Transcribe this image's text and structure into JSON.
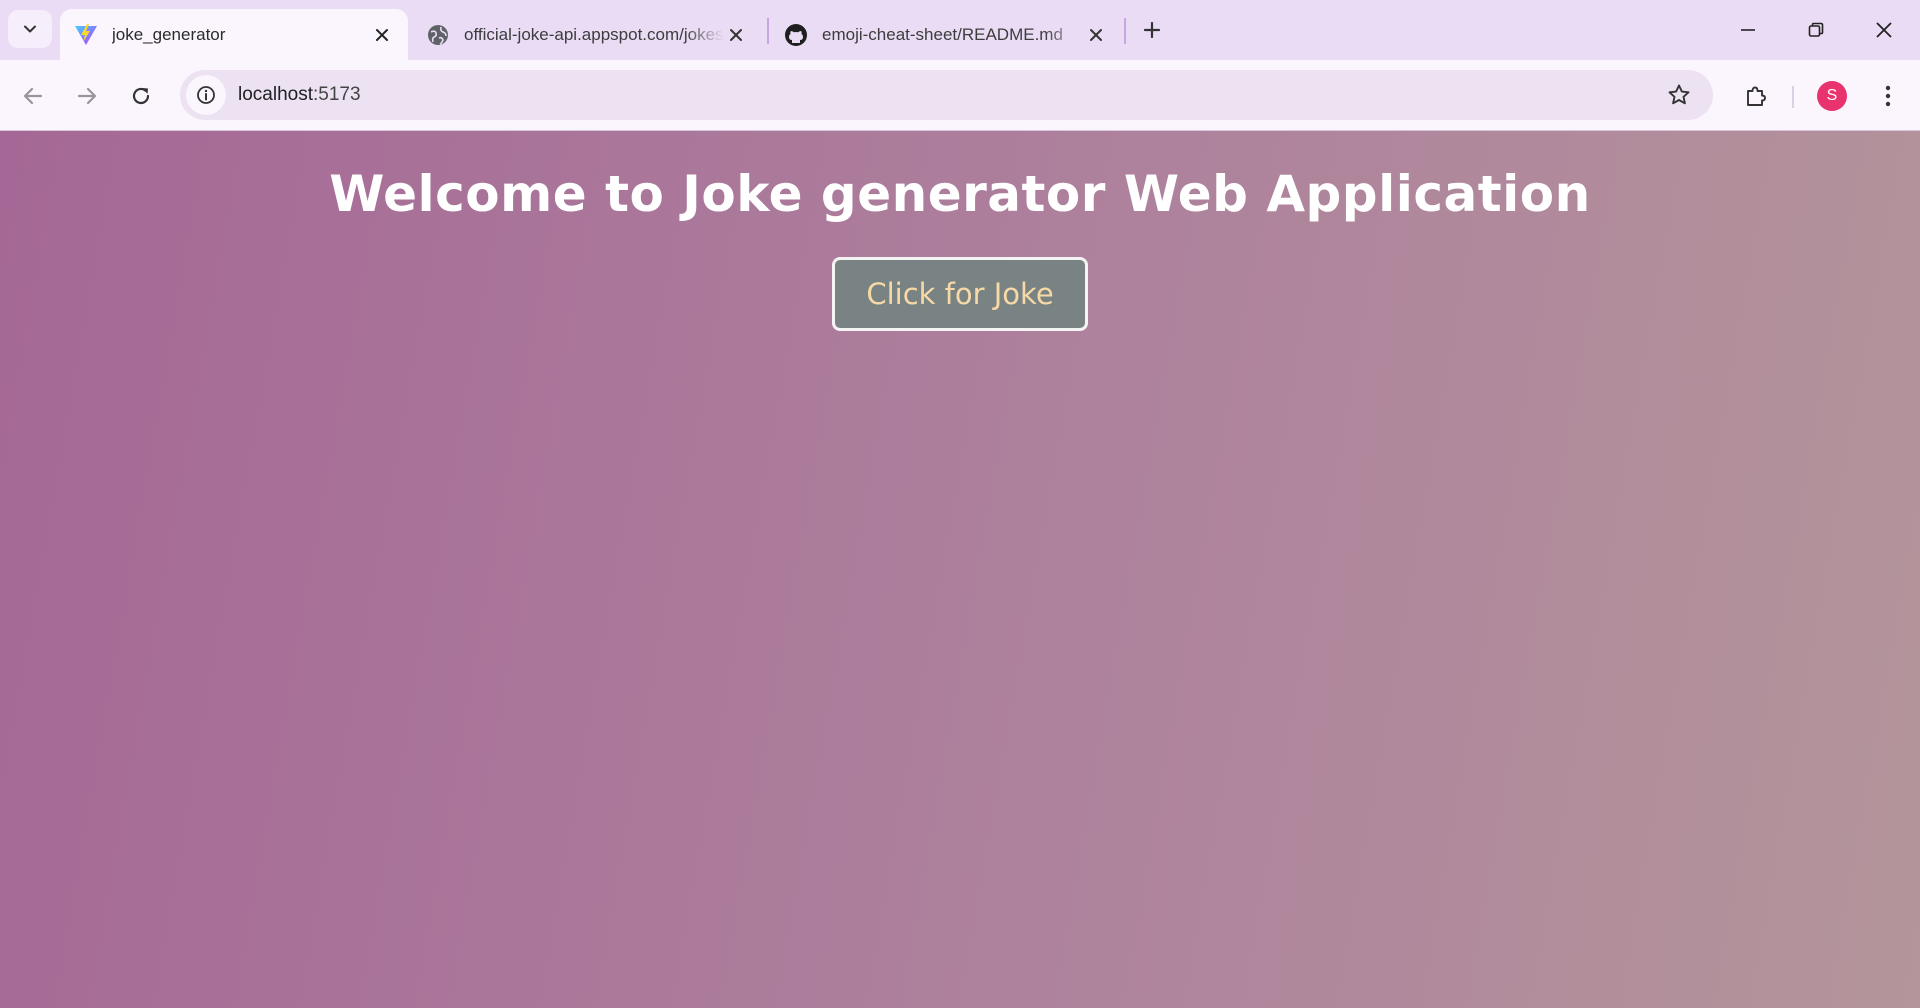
{
  "browser": {
    "tabs": [
      {
        "title": "joke_generator",
        "favicon": "vite-logo-icon",
        "active": true
      },
      {
        "title": "official-joke-api.appspot.com/jokes",
        "favicon": "globe-icon",
        "active": false
      },
      {
        "title": "emoji-cheat-sheet/README.md",
        "favicon": "github-icon",
        "active": false
      }
    ],
    "url_host": "localhost",
    "url_port": ":5173",
    "profile_initial": "S"
  },
  "colors": {
    "tab_strip": "#eadcf4",
    "toolbar": "#fbf6fd",
    "omnibox": "#ece2f2",
    "avatar": "#e8336f",
    "page_gradient_start": "#a56896",
    "page_gradient_end": "#b4959b",
    "button_bg": "#7a8383",
    "button_text": "#f6d9a6"
  },
  "page": {
    "title": "Welcome to Joke generator Web Application",
    "button_label": "Click for Joke"
  }
}
